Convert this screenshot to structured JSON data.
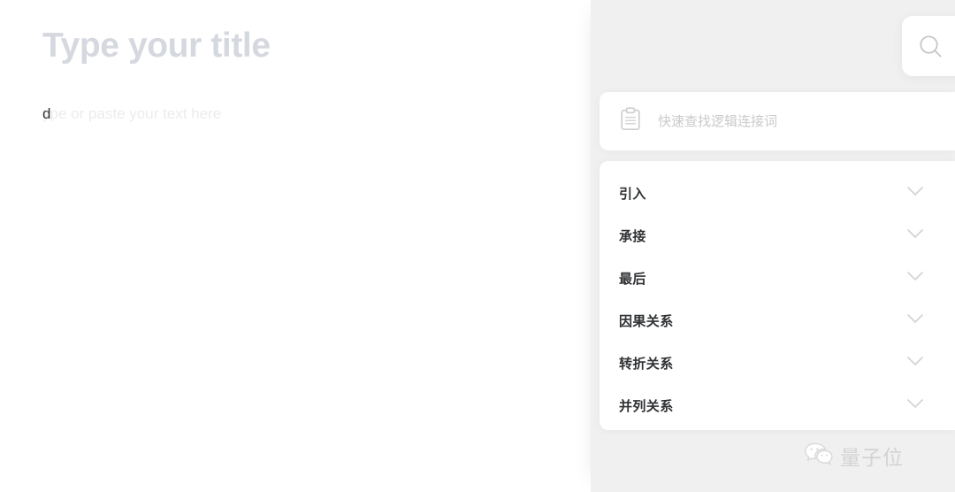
{
  "editor": {
    "title_placeholder": "Type your title",
    "body_typed_text": "d",
    "body_placeholder": "ype or paste your text here"
  },
  "topbar": {
    "search_icon": "search-icon"
  },
  "finder_panel": {
    "search": {
      "icon": "clipboard-icon",
      "value": "",
      "placeholder": "快速查找逻辑连接词"
    },
    "expand_icon": "chevron-down-icon",
    "categories": [
      {
        "label": "引入"
      },
      {
        "label": "承接"
      },
      {
        "label": "最后"
      },
      {
        "label": "因果关系"
      },
      {
        "label": "转折关系"
      },
      {
        "label": "并列关系"
      }
    ]
  },
  "watermark": {
    "icon": "wechat-icon",
    "text": "量子位"
  },
  "colors": {
    "page_background": "#ffffff",
    "panel_background": "#f0f0f1",
    "card_background": "#ffffff",
    "title_placeholder": "#d5d8df",
    "body_placeholder": "#ececef",
    "body_text": "#333333",
    "category_label": "#2f3133",
    "icon_muted": "#cccccc",
    "watermark": "#d3d3d5"
  }
}
